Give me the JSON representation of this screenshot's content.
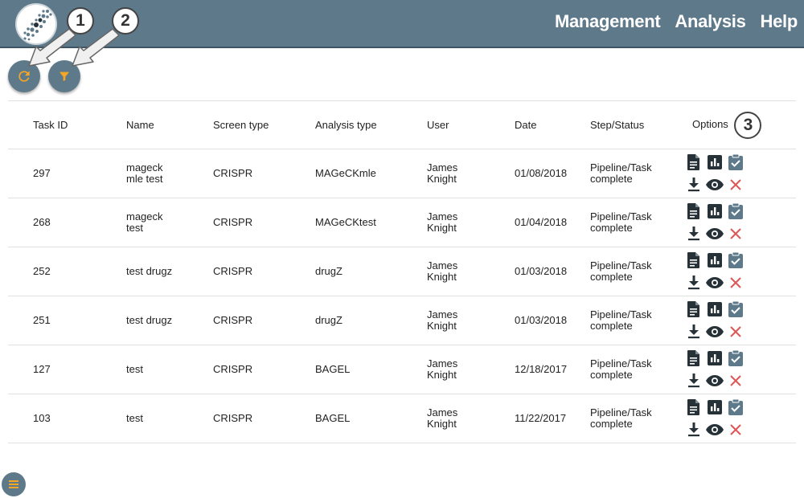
{
  "nav": {
    "management": "Management",
    "analysis": "Analysis",
    "help": "Help"
  },
  "callouts": {
    "one": "1",
    "two": "2",
    "three": "3"
  },
  "icons": {
    "refresh": "refresh-icon",
    "filter": "filter-icon",
    "report": "document-icon",
    "chart": "bar-chart-icon",
    "clipboard": "clipboard-check-icon",
    "download": "download-icon",
    "view": "eye-icon",
    "delete": "close-icon",
    "menu": "menu-icon"
  },
  "colors": {
    "header": "#5e7a8a",
    "accent": "#f5a623",
    "danger": "#e05555",
    "icon_dark": "#263238",
    "clipboard": "#5e7a8a"
  },
  "table": {
    "headers": {
      "task_id": "Task ID",
      "name": "Name",
      "screen_type": "Screen type",
      "analysis_type": "Analysis type",
      "user": "User",
      "date": "Date",
      "status": "Step/Status",
      "options": "Options"
    },
    "rows": [
      {
        "task_id": "297",
        "name": "mageck mle test",
        "screen_type": "CRISPR",
        "analysis_type": "MAGeCKmle",
        "user": "James Knight",
        "date": "01/08/2018",
        "status": "Pipeline/Task complete"
      },
      {
        "task_id": "268",
        "name": "mageck test",
        "screen_type": "CRISPR",
        "analysis_type": "MAGeCKtest",
        "user": "James Knight",
        "date": "01/04/2018",
        "status": "Pipeline/Task complete"
      },
      {
        "task_id": "252",
        "name": "test drugz",
        "screen_type": "CRISPR",
        "analysis_type": "drugZ",
        "user": "James Knight",
        "date": "01/03/2018",
        "status": "Pipeline/Task complete"
      },
      {
        "task_id": "251",
        "name": "test drugz",
        "screen_type": "CRISPR",
        "analysis_type": "drugZ",
        "user": "James Knight",
        "date": "01/03/2018",
        "status": "Pipeline/Task complete"
      },
      {
        "task_id": "127",
        "name": "test",
        "screen_type": "CRISPR",
        "analysis_type": "BAGEL",
        "user": "James Knight",
        "date": "12/18/2017",
        "status": "Pipeline/Task complete"
      },
      {
        "task_id": "103",
        "name": "test",
        "screen_type": "CRISPR",
        "analysis_type": "BAGEL",
        "user": "James Knight",
        "date": "11/22/2017",
        "status": "Pipeline/Task complete"
      }
    ]
  }
}
